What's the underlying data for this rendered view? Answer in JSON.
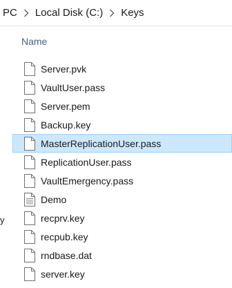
{
  "breadcrumb": {
    "items": [
      "PC",
      "Local Disk (C:)",
      "Keys"
    ]
  },
  "nav_pane": {
    "fragment": "y"
  },
  "column_header": {
    "name_label": "Name"
  },
  "files": [
    {
      "name": "Server.pvk",
      "icon": "file-icon",
      "selected": false
    },
    {
      "name": "VaultUser.pass",
      "icon": "file-icon",
      "selected": false
    },
    {
      "name": "Server.pem",
      "icon": "file-icon",
      "selected": false
    },
    {
      "name": "Backup.key",
      "icon": "file-icon",
      "selected": false
    },
    {
      "name": "MasterReplicationUser.pass",
      "icon": "file-icon",
      "selected": true
    },
    {
      "name": "ReplicationUser.pass",
      "icon": "file-icon",
      "selected": false
    },
    {
      "name": "VaultEmergency.pass",
      "icon": "file-icon",
      "selected": false
    },
    {
      "name": "Demo",
      "icon": "text-document-icon",
      "selected": false
    },
    {
      "name": "recprv.key",
      "icon": "file-icon",
      "selected": false
    },
    {
      "name": "recpub.key",
      "icon": "file-icon",
      "selected": false
    },
    {
      "name": "rndbase.dat",
      "icon": "file-icon",
      "selected": false
    },
    {
      "name": "server.key",
      "icon": "file-icon",
      "selected": false
    }
  ],
  "colors": {
    "selection_bg": "#cce8ff",
    "selection_border": "#99d1ff",
    "header_text": "#4c607a"
  }
}
